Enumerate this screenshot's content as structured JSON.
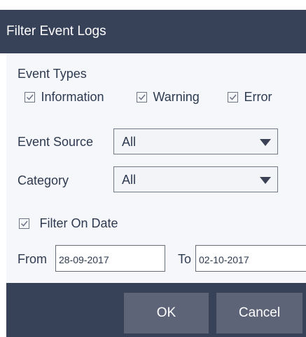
{
  "dialog": {
    "title": "Filter Event Logs"
  },
  "event_types": {
    "heading": "Event Types",
    "options": [
      {
        "label": "Information",
        "checked": true
      },
      {
        "label": "Warning",
        "checked": true
      },
      {
        "label": "Error",
        "checked": true
      }
    ]
  },
  "event_source": {
    "label": "Event Source",
    "selected": "All"
  },
  "category": {
    "label": "Category",
    "selected": "All"
  },
  "filter_on_date": {
    "label": "Filter On Date",
    "checked": true
  },
  "date_range": {
    "from_label": "From",
    "from_value": "28-09-2017",
    "to_label": "To",
    "to_value": "02-10-2017"
  },
  "buttons": {
    "ok": "OK",
    "cancel": "Cancel"
  },
  "colors": {
    "title_bar": "#374158",
    "button_bg": "#5d6478",
    "content_bg": "#f6f7fb",
    "text": "#2e3a4f"
  },
  "icons": {
    "checkbox_mark": "checkmark-icon",
    "dropdown_arrow": "caret-down-icon"
  }
}
